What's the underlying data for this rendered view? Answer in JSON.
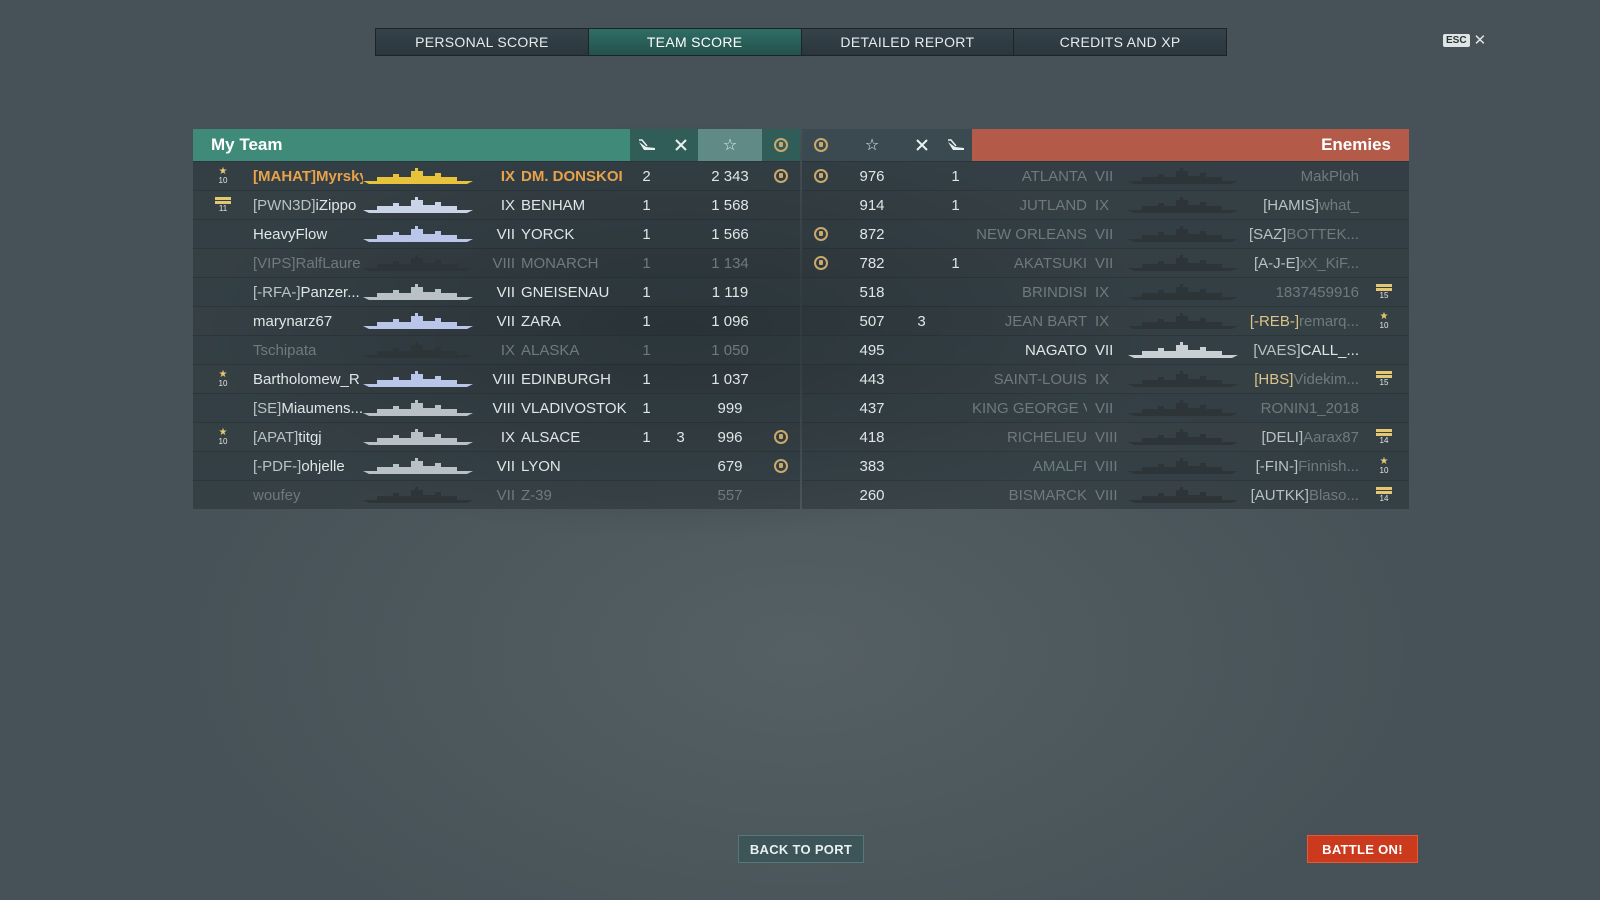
{
  "tabs": [
    "PERSONAL SCORE",
    "TEAM SCORE",
    "DETAILED REPORT",
    "CREDITS AND XP"
  ],
  "active_tab": 1,
  "esc": {
    "key": "ESC",
    "close": "✕"
  },
  "my_team": {
    "title": "My Team",
    "header_icons": [
      "plane-icon",
      "crossed-swords-icon",
      "star-icon",
      "medal-icon"
    ],
    "rows": [
      {
        "badge": "star",
        "badge_num": "10",
        "clan": "[MAHAT]",
        "name": "Myrsky",
        "tier": "IX",
        "ship": "DM. DONSKOI",
        "planes": "2",
        "kills": "",
        "score": "2 343",
        "medal": true,
        "state": "me",
        "ship_color": "#e8c23a"
      },
      {
        "badge": "bar",
        "badge_num": "11",
        "clan": "[PWN3D]",
        "name": "iZippo",
        "tier": "IX",
        "ship": "BENHAM",
        "planes": "1",
        "kills": "",
        "score": "1 568",
        "medal": false,
        "state": "alive",
        "ship_color": "#c9d4e8"
      },
      {
        "badge": "",
        "badge_num": "",
        "clan": "",
        "name": "HeavyFlow",
        "tier": "VII",
        "ship": "YORCK",
        "planes": "1",
        "kills": "",
        "score": "1 566",
        "medal": false,
        "state": "alive",
        "ship_color": "#b9c6ea"
      },
      {
        "badge": "",
        "badge_num": "",
        "clan": "[VIPS]",
        "name": "RalfLaure",
        "tier": "VIII",
        "ship": "MONARCH",
        "planes": "1",
        "kills": "",
        "score": "1 134",
        "medal": false,
        "state": "dead",
        "ship_color": "#2d3538"
      },
      {
        "badge": "",
        "badge_num": "",
        "clan": "[-RFA-]",
        "name": "Panzer...",
        "tier": "VII",
        "ship": "GNEISENAU",
        "planes": "1",
        "kills": "",
        "score": "1 119",
        "medal": false,
        "state": "alive",
        "ship_color": "#b9c0c6"
      },
      {
        "badge": "",
        "badge_num": "",
        "clan": "",
        "name": "marynarz67",
        "tier": "VII",
        "ship": "ZARA",
        "planes": "1",
        "kills": "",
        "score": "1 096",
        "medal": false,
        "state": "alive",
        "ship_color": "#b9c6ea"
      },
      {
        "badge": "",
        "badge_num": "",
        "clan": "",
        "name": "Tschipata",
        "tier": "IX",
        "ship": "ALASKA",
        "planes": "1",
        "kills": "",
        "score": "1 050",
        "medal": false,
        "state": "dead",
        "ship_color": "#2d3538"
      },
      {
        "badge": "star",
        "badge_num": "10",
        "clan": "",
        "name": "Bartholomew_R",
        "tier": "VIII",
        "ship": "EDINBURGH",
        "planes": "1",
        "kills": "",
        "score": "1 037",
        "medal": false,
        "state": "alive",
        "ship_color": "#b9c6ea"
      },
      {
        "badge": "",
        "badge_num": "",
        "clan": "[SE]",
        "name": "Miaumens...",
        "tier": "VIII",
        "ship": "VLADIVOSTOK",
        "planes": "1",
        "kills": "",
        "score": "999",
        "medal": false,
        "state": "alive",
        "ship_color": "#b9c0c6"
      },
      {
        "badge": "star",
        "badge_num": "10",
        "clan": "[APAT]",
        "name": "titgj",
        "tier": "IX",
        "ship": "ALSACE",
        "planes": "1",
        "kills": "3",
        "score": "996",
        "medal": true,
        "state": "alive",
        "ship_color": "#b9c0c6"
      },
      {
        "badge": "",
        "badge_num": "",
        "clan": "[-PDF-]",
        "name": "ohjelle",
        "tier": "VII",
        "ship": "LYON",
        "planes": "",
        "kills": "",
        "score": "679",
        "medal": true,
        "state": "alive",
        "ship_color": "#b9c0c6"
      },
      {
        "badge": "",
        "badge_num": "",
        "clan": "",
        "name": "woufey",
        "tier": "VII",
        "ship": "Z-39",
        "planes": "",
        "kills": "",
        "score": "557",
        "medal": false,
        "state": "dead",
        "ship_color": "#2d3538"
      }
    ]
  },
  "enemies": {
    "title": "Enemies",
    "header_icons": [
      "medal-icon",
      "star-icon",
      "crossed-swords-icon",
      "plane-icon"
    ],
    "rows": [
      {
        "medal": true,
        "score": "976",
        "kills": "",
        "planes": "1",
        "ship": "ATLANTA",
        "tier": "VII",
        "clan": "",
        "name": "MakPloh",
        "badge": "",
        "badge_num": "",
        "state": "dead",
        "ship_color": "#2d3538"
      },
      {
        "medal": false,
        "score": "914",
        "kills": "",
        "planes": "1",
        "ship": "JUTLAND",
        "tier": "IX",
        "clan": "[HAMIS]",
        "name": "what_",
        "badge": "",
        "badge_num": "",
        "state": "dead-clanlit",
        "ship_color": "#2d3538"
      },
      {
        "medal": true,
        "score": "872",
        "kills": "",
        "planes": "",
        "ship": "NEW ORLEANS",
        "tier": "VII",
        "clan": "[SAZ]",
        "name": "BOTTEK...",
        "badge": "",
        "badge_num": "",
        "state": "dead-clanlit",
        "ship_color": "#2d3538"
      },
      {
        "medal": true,
        "score": "782",
        "kills": "",
        "planes": "1",
        "ship": "AKATSUKI",
        "tier": "VII",
        "clan": "[A-J-E]",
        "name": "xX_KiF...",
        "badge": "",
        "badge_num": "",
        "state": "dead-clanlit",
        "ship_color": "#2d3538"
      },
      {
        "medal": false,
        "score": "518",
        "kills": "",
        "planes": "",
        "ship": "BRINDISI",
        "tier": "IX",
        "clan": "",
        "name": "1837459916",
        "badge": "bar",
        "badge_num": "15",
        "state": "dead",
        "ship_color": "#2d3538"
      },
      {
        "medal": false,
        "score": "507",
        "kills": "3",
        "planes": "",
        "ship": "JEAN BART",
        "tier": "IX",
        "clan": "[-REB-]",
        "name": "remarq...",
        "badge": "star",
        "badge_num": "10",
        "state": "dead-goldclan",
        "ship_color": "#2d3538"
      },
      {
        "medal": false,
        "score": "495",
        "kills": "",
        "planes": "",
        "ship": "NAGATO",
        "tier": "VII",
        "clan": "[VAES]",
        "name": "CALL_...",
        "badge": "",
        "badge_num": "",
        "state": "alive",
        "ship_color": "#c9d0d4"
      },
      {
        "medal": false,
        "score": "443",
        "kills": "",
        "planes": "",
        "ship": "SAINT-LOUIS",
        "tier": "IX",
        "clan": "[HBS]",
        "name": "Videkim...",
        "badge": "bar",
        "badge_num": "15",
        "state": "dead-goldclan",
        "ship_color": "#2d3538"
      },
      {
        "medal": false,
        "score": "437",
        "kills": "",
        "planes": "",
        "ship": "KING GEORGE V",
        "tier": "VII",
        "clan": "",
        "name": "RONIN1_2018",
        "badge": "",
        "badge_num": "",
        "state": "dead",
        "ship_color": "#2d3538"
      },
      {
        "medal": false,
        "score": "418",
        "kills": "",
        "planes": "",
        "ship": "RICHELIEU",
        "tier": "VIII",
        "clan": "[DELI]",
        "name": "Aarax87",
        "badge": "bar",
        "badge_num": "14",
        "state": "dead-clanlit",
        "ship_color": "#2d3538"
      },
      {
        "medal": false,
        "score": "383",
        "kills": "",
        "planes": "",
        "ship": "AMALFI",
        "tier": "VIII",
        "clan": "[-FIN-]",
        "name": "Finnish...",
        "badge": "star",
        "badge_num": "10",
        "state": "dead-clanlit",
        "ship_color": "#2d3538"
      },
      {
        "medal": false,
        "score": "260",
        "kills": "",
        "planes": "",
        "ship": "BISMARCK",
        "tier": "VIII",
        "clan": "[AUTKK]",
        "name": "Blaso...",
        "badge": "bar",
        "badge_num": "14",
        "state": "dead-clanlit",
        "ship_color": "#2d3538"
      }
    ]
  },
  "buttons": {
    "back": "BACK TO PORT",
    "battle": "BATTLE ON!"
  },
  "colors": {
    "my_team": "#3f8a78",
    "enemies": "#b35a48",
    "self_player": "#e8a24a",
    "battle_button": "#cc3a1e"
  }
}
